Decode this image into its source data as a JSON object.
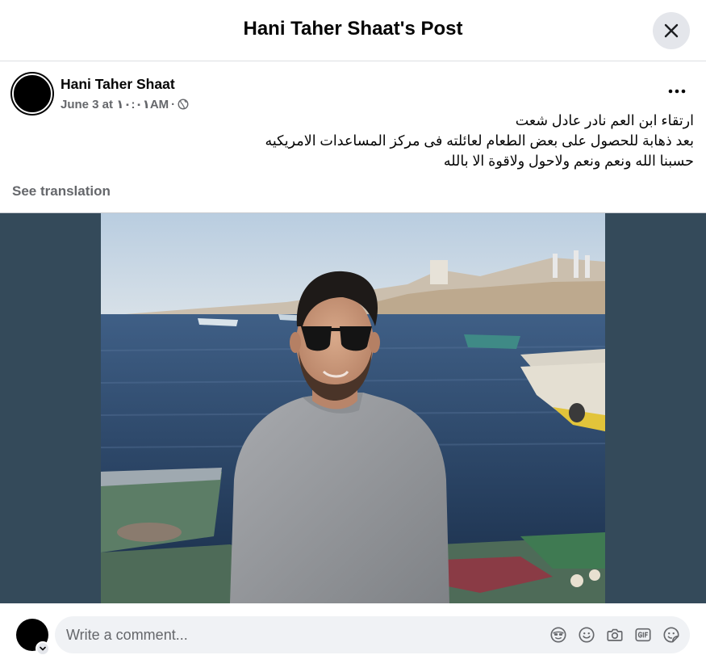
{
  "dialog": {
    "title": "Hani Taher Shaat's Post",
    "close_icon": "close-icon"
  },
  "post": {
    "author": "Hani Taher Shaat",
    "date": "June 3 at ١٠:٠١AM",
    "separator": "·",
    "privacy_icon": "globe-icon",
    "more_icon": "more-horizontal-icon",
    "text_lines": [
      "ارتقاء ابن العم نادر عادل شعت",
      "بعد ذهابة للحصول على بعض الطعام لعائلته فى مركز المساعدات الامريكيه",
      "حسبنا الله ونعم ونعم ولاحول ولاقوة الا بالله"
    ],
    "see_translation": "See translation"
  },
  "comment": {
    "placeholder": "Write a comment...",
    "icons": [
      "avatar-sticker-icon",
      "emoji-icon",
      "camera-icon",
      "gif-icon",
      "sticker-icon"
    ]
  },
  "colors": {
    "secondary_text": "#65676b",
    "input_bg": "#f0f2f5",
    "photo_backdrop": "#344a5a"
  }
}
